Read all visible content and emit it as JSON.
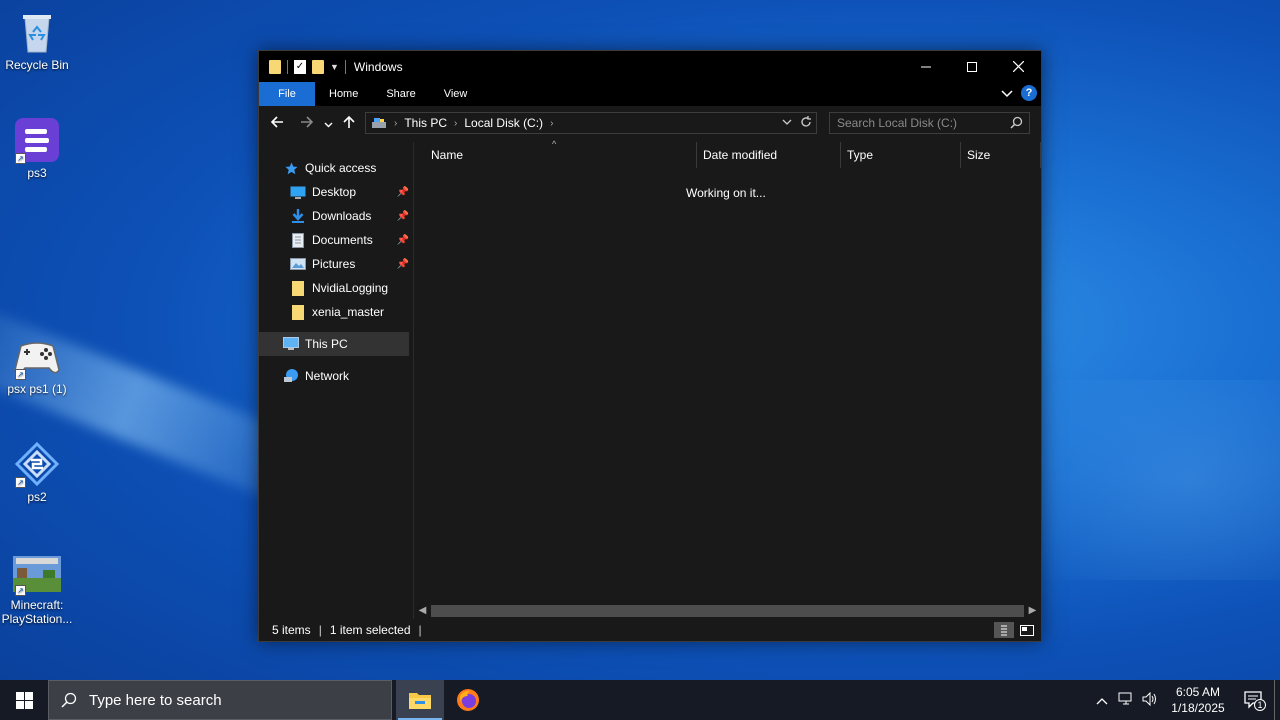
{
  "desktop": {
    "icons": [
      {
        "label": "Recycle Bin"
      },
      {
        "label": "ps3"
      },
      {
        "label": "psx ps1 (1)"
      },
      {
        "label": "ps2"
      },
      {
        "label": "Minecraft: PlayStation..."
      }
    ]
  },
  "window": {
    "title": "Windows",
    "ribbon_tabs": [
      "File",
      "Home",
      "Share",
      "View"
    ],
    "help_label": "?",
    "breadcrumb": [
      "This PC",
      "Local Disk (C:)"
    ],
    "search_placeholder": "Search Local Disk (C:)",
    "nav_pane": {
      "quick_access": "Quick access",
      "pinned": [
        {
          "label": "Desktop",
          "icon": "desktop-icon"
        },
        {
          "label": "Downloads",
          "icon": "download-icon"
        },
        {
          "label": "Documents",
          "icon": "documents-icon"
        },
        {
          "label": "Pictures",
          "icon": "pictures-icon"
        },
        {
          "label": "NvidiaLogging",
          "icon": "folder-icon"
        },
        {
          "label": "xenia_master",
          "icon": "folder-icon"
        }
      ],
      "this_pc": "This PC",
      "network": "Network"
    },
    "columns": [
      "Name",
      "Date modified",
      "Type",
      "Size"
    ],
    "status_message": "Working on it...",
    "status_bar": {
      "items": "5 items",
      "selected": "1 item selected"
    }
  },
  "taskbar": {
    "search_placeholder": "Type here to search",
    "time": "6:05 AM",
    "date": "1/18/2025",
    "notification_count": "1"
  },
  "colors": {
    "accent": "#1a6dd2",
    "window_bg": "#191919",
    "titlebar_bg": "#000000",
    "folder_yellow": "#f8d775"
  }
}
